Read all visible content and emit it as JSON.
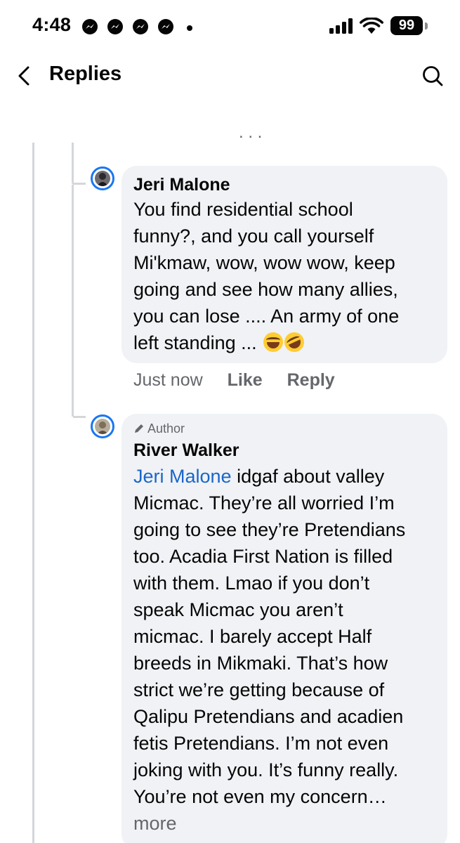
{
  "status_bar": {
    "time": "4:48",
    "battery": "99",
    "notification_icons": [
      "messenger-icon",
      "messenger-icon",
      "messenger-icon",
      "messenger-icon"
    ]
  },
  "header": {
    "title": "Replies"
  },
  "colors": {
    "accent": "#1877f2",
    "mention": "#1a66c9",
    "bubble": "#f0f2f5",
    "secondary_text": "#65676b"
  },
  "comments": [
    {
      "author": "Jeri Malone",
      "lines": [
        "You find residential school",
        "funny?, and you call yourself",
        "Mi'kmaw, wow, wow wow, keep",
        "going and see how many allies,",
        "you can lose .... An army of one",
        "left standing ..."
      ],
      "emojis": [
        "face-with-tears-of-joy",
        "rolling-on-the-floor-laughing"
      ],
      "time": "Just now",
      "like_label": "Like",
      "reply_label": "Reply"
    },
    {
      "badge": "Author",
      "author": "River Walker",
      "mention": "Jeri Malone",
      "first_line_rest": "idgaf about valley",
      "lines": [
        "Micmac. They’re all worried I’m",
        "going to see they’re Pretendians",
        "too. Acadia First Nation is filled",
        "with them. Lmao if you don’t",
        "speak Micmac you aren’t",
        "micmac. I barely accept Half",
        "breeds in Mikmaki. That’s how",
        "strict we’re getting because of",
        "Qalipu Pretendians and acadien",
        "fetis Pretendians. I’m not even",
        "joking with you. It’s funny really.",
        "You’re not even my concern…"
      ],
      "more_label": "more"
    }
  ]
}
